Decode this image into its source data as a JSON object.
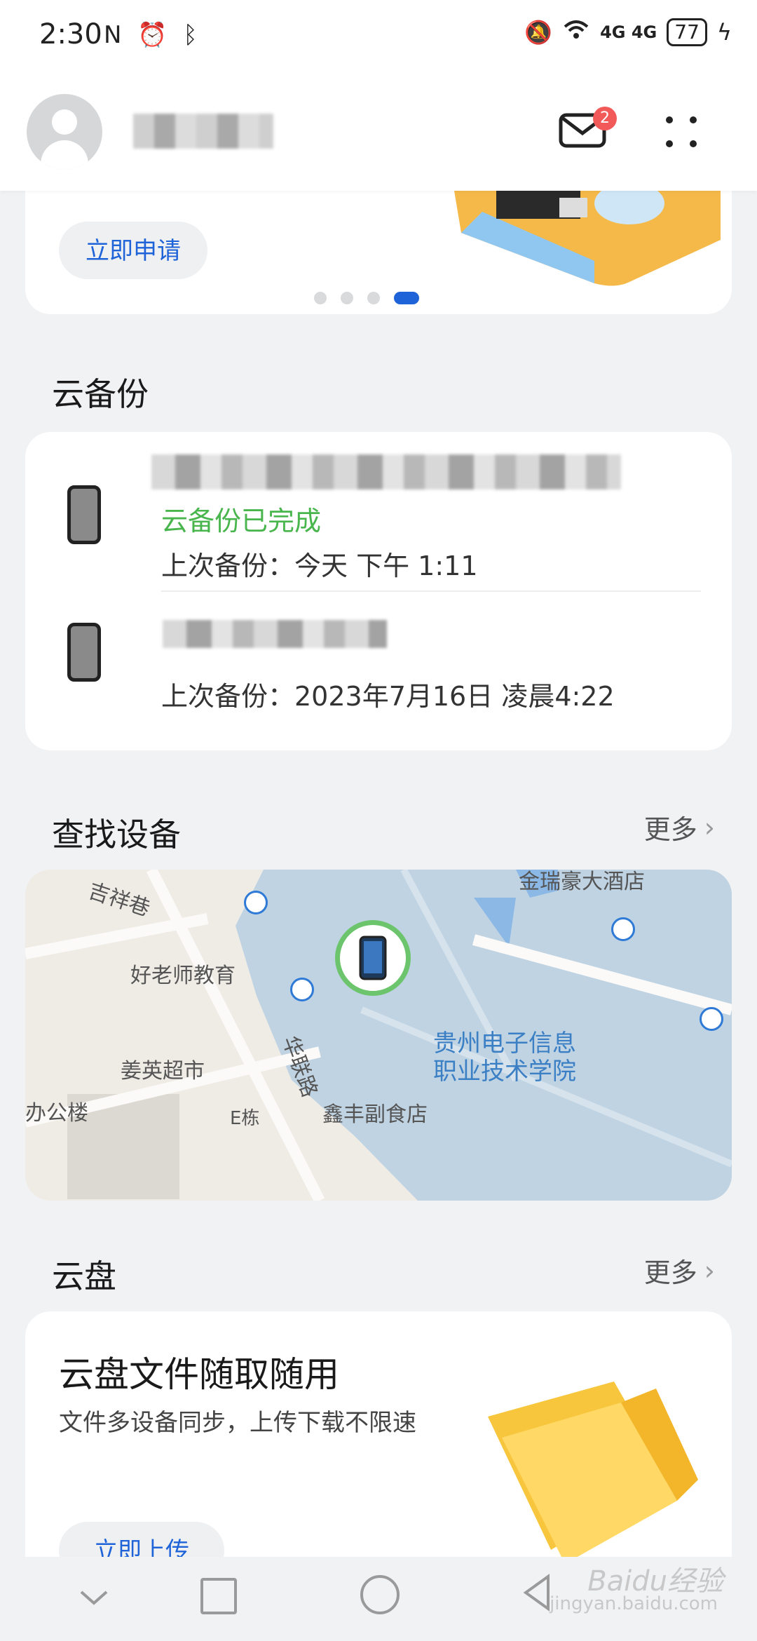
{
  "status_bar": {
    "time": "2:30",
    "left_icons": "N ⏰ ᛒ",
    "network_right": "4G 4G",
    "battery": "77"
  },
  "header": {
    "mail_badge": "2"
  },
  "banner": {
    "apply_label": "立即申请",
    "page_dots": 4,
    "active_dot": 4
  },
  "backup": {
    "section_title": "云备份",
    "devices": [
      {
        "status": "云备份已完成",
        "last_backup": "上次备份：今天 下午 1:11"
      },
      {
        "last_backup": "上次备份：2023年7月16日 凌晨4:22"
      }
    ]
  },
  "find_device": {
    "section_title": "查找设备",
    "more_label": "更多",
    "map_labels": [
      "吉祥巷",
      "好老师教育",
      "姜英超市",
      "办公楼",
      "E栋",
      "鑫丰副食店",
      "华联路",
      "贵州电子信息",
      "职业技术学院",
      "金瑞豪大酒店"
    ]
  },
  "cloud_drive": {
    "section_title": "云盘",
    "more_label": "更多",
    "card_title": "云盘文件随取随用",
    "card_desc": "文件多设备同步，上传下载不限速",
    "upload_label": "立即上传"
  },
  "watermark": {
    "main": "Baidu经验",
    "sub": "jingyan.baidu.com"
  }
}
